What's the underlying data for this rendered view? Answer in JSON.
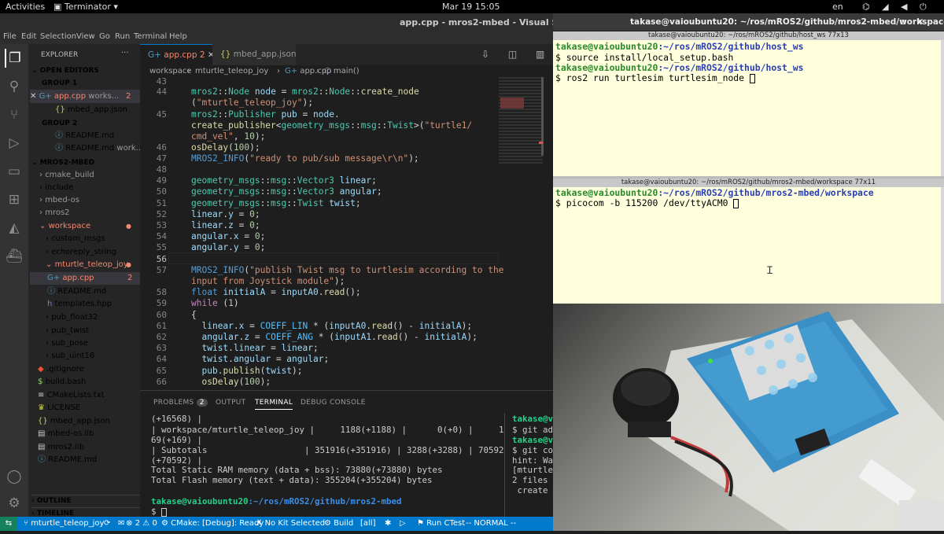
{
  "topbar": {
    "activities": "Activities",
    "app": "Terminator",
    "clock": "Mar 19  15:05",
    "lang": "en"
  },
  "vscode": {
    "title": "app.cpp - mros2-mbed - Visual Studio Code",
    "menu": [
      "File",
      "Edit",
      "Selection",
      "View",
      "Go",
      "Run",
      "Terminal",
      "Help"
    ],
    "explorer_title": "EXPLORER",
    "open_editors": "OPEN EDITORS",
    "group1": "GROUP 1",
    "g1_items": [
      {
        "name": "app.cpp",
        "desc": "works...",
        "badge": "2"
      },
      {
        "name": "mbed_app.json",
        "desc": "",
        "badge": ""
      }
    ],
    "group2": "GROUP 2",
    "g2_items": [
      {
        "name": "README.md",
        "desc": ""
      },
      {
        "name": "README.md",
        "desc": "work..."
      }
    ],
    "project": "MROS2-MBED",
    "tree": [
      "cmake_build",
      "include",
      "mbed-os",
      "mros2",
      "workspace",
      "custom_msgs",
      "echoreply_string",
      "mturtle_teleop_joy",
      "app.cpp",
      "README.md",
      "templates.hpp",
      "pub_float32",
      "pub_twist",
      "sub_pose",
      "sub_uint16",
      ".gitignore",
      "build.bash",
      "CMakeLists.txt",
      "LICENSE",
      "mbed_app.json",
      "mbed-os.lib",
      "mros2.lib",
      "README.md"
    ],
    "outline": "OUTLINE",
    "timeline": "TIMELINE",
    "tabs": [
      {
        "name": "app.cpp",
        "badge": "2"
      },
      {
        "name": "mbed_app.json"
      }
    ],
    "breadcrumb": [
      "workspace",
      "mturtle_teleop_joy",
      "app.cpp",
      "main()"
    ],
    "line_numbers": [
      "43",
      "44",
      "",
      "45",
      "",
      "46",
      "47",
      "48",
      "49",
      "50",
      "51",
      "52",
      "53",
      "54",
      "55",
      "56",
      "57",
      "",
      "58",
      "59",
      "60",
      "61",
      "62",
      "63",
      "64",
      "65",
      "66"
    ],
    "panel_tabs": {
      "problems": "PROBLEMS",
      "problems_count": "2",
      "output": "OUTPUT",
      "terminal": "TERMINAL",
      "debug": "DEBUG CONSOLE"
    },
    "terminal_lines": [
      "(+16568) |",
      "| workspace/mturtle_teleop_joy |     1188(+1188) |      0(+0) |     1",
      "69(+169) |",
      "| Subtotals                   | 351916(+351916) | 3288(+3288) | 70592",
      "(+70592) |",
      "Total Static RAM memory (data + bss): 73880(+73880) bytes",
      "Total Flash memory (text + data): 355204(+355204) bytes"
    ],
    "terminal_prompt_user": "takase@vaioubuntu20",
    "terminal_prompt_path": ":~/ros/mROS2/github/mros2-mbed",
    "terminal_prompt_end": "$ ",
    "side_terminal": [
      "takase@v",
      "$ git ad",
      "takase@v",
      "$ git co",
      "hint: Wa",
      "[mturtle",
      "2 files",
      " create"
    ],
    "status": {
      "branch": "mturtle_teleop_joy",
      "errors": "2",
      "warnings": "0",
      "cmake": "CMake: [Debug]: Ready",
      "kit": "No Kit Selected",
      "build": "Build",
      "all": "[all]",
      "ctest": "Run CTest",
      "mode": "-- NORMAL --"
    }
  },
  "terminator": {
    "title": "takase@vaioubuntu20: ~/ros/mROS2/github/mros2-mbed/workspace",
    "pane1_title": "takase@vaioubuntu20: ~/ros/mROS2/github/host_ws 77x13",
    "pane1": [
      {
        "user": "takase@vaioubuntu20",
        "path": ":~/ros/mROS2/github/host_ws"
      },
      {
        "cmd": "$ source install/local_setup.bash"
      },
      {
        "user": "takase@vaioubuntu20",
        "path": ":~/ros/mROS2/github/host_ws"
      },
      {
        "cmd": "$ ros2 run turtlesim turtlesim_node "
      }
    ],
    "pane2_title": "takase@vaioubuntu20: ~/ros/mROS2/github/mros2-mbed/workspace 77x11",
    "pane2": [
      {
        "user": "takase@vaioubuntu20",
        "path": ":~/ros/mROS2/github/mros2-mbed/workspace"
      },
      {
        "cmd": "$ picocom -b 115200 /dev/ttyACM0 "
      }
    ]
  }
}
